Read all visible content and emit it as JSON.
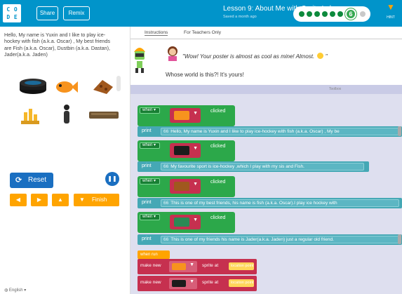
{
  "header": {
    "logo_letters": [
      "C",
      "O",
      "D",
      "E"
    ],
    "share_label": "Share",
    "remix_label": "Remix",
    "lesson_title": "Lesson 9: About Me with Sprite Lab",
    "lesson_subtitle": "Saved a month ago",
    "progress_current": "6",
    "progress_total": 7,
    "hint_label": "HINT"
  },
  "stage": {
    "text": "Hello, My name is Yuxin and I like to play ice-hockey with fish (a.k.a. Oscar) , My best friends are Fish (a.k.a. Oscar), Dustbin (a.k.a. Dastan), Jader(a.k.a. Jaden)",
    "sprites": [
      "speaker-sprite",
      "fish-sprite",
      "cookie-sprite",
      "trophy-sprite",
      "figure-sprite",
      "bench-sprite"
    ]
  },
  "controls": {
    "reset_label": "Reset",
    "finish_label": "Finish",
    "language": "English"
  },
  "tabs": {
    "instructions": "Instructions",
    "teachers_only": "For Teachers Only"
  },
  "instructions": {
    "quote": "\"Wow! Your poster is almost as cool as mine! Almost.",
    "quote_end": "\"",
    "line2": "Whose world is this?! It's yours!"
  },
  "toolbox": {
    "label": "Toolbox"
  },
  "workspace": {
    "when_label": "when",
    "clicked_label": "clicked",
    "print_label": "print",
    "text_marker": "66",
    "blocks": [
      {
        "sprite": "fish",
        "print_text": "Hello, My name is Yuxin and I like to play ice-hockey with fish (a.k.a. Oscar) , My be"
      },
      {
        "sprite": "puck",
        "print_text": "My favourite sport is ice-hockey ,which I play with my sis and Fish."
      },
      {
        "sprite": "cookie",
        "print_text": "This is one of my best friends, his name is fish (a.k.a. Oscar).I play ice hockey with"
      },
      {
        "sprite": "trash",
        "print_text": "This is one of my friends his name is Jader(a.k.a. Jaden) just a regular old friend."
      }
    ],
    "when_run_label": "when run",
    "make_new_label": "make new",
    "sprite_at_label": "sprite at",
    "make_blocks": [
      {
        "sprite": "fish",
        "location": "location point"
      },
      {
        "sprite": "puck",
        "location": "location point"
      }
    ]
  },
  "colors": {
    "header": "#0194ca",
    "event_block": "#2ca84a",
    "print_block": "#45a8b5",
    "sprite_slot": "#c6304f",
    "accent": "#ffa400",
    "workspace": "#dedfef"
  }
}
